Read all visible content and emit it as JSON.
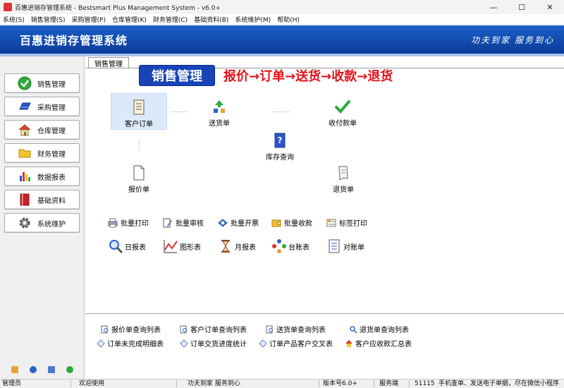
{
  "window": {
    "title": "百惠进销存管理系统 - Bestsmart Plus Management System - v6.0+",
    "minimize": "—",
    "maximize": "☐",
    "close": "✕"
  },
  "menu": [
    "系统(S)",
    "销售管理(S)",
    "采购管理(P)",
    "仓库管理(K)",
    "财务管理(C)",
    "基础资料(B)",
    "系统维护(M)",
    "帮助(H)"
  ],
  "banner": {
    "title": "百惠进销存管理系统",
    "slogan": "功夫到家 服务到心"
  },
  "sidebar": {
    "items": [
      {
        "label": "销售管理",
        "icon": "check-icon"
      },
      {
        "label": "采购管理",
        "icon": "card-icon"
      },
      {
        "label": "仓库管理",
        "icon": "house-icon"
      },
      {
        "label": "财务管理",
        "icon": "folder-icon"
      },
      {
        "label": "数据报表",
        "icon": "bar-chart-icon"
      },
      {
        "label": "基础资料",
        "icon": "book-icon"
      },
      {
        "label": "系统维护",
        "icon": "gear-icon"
      }
    ]
  },
  "main": {
    "tab": "销售管理",
    "heading": "销售管理",
    "flow": "报价→订单→送货→收款→退货",
    "nodes": {
      "order": "客户订单",
      "delivery": "送货单",
      "payment": "收付款单",
      "inventory": "库存查询",
      "quote": "报价单",
      "return": "退货单"
    },
    "tools": [
      "批量打印",
      "批量审核",
      "批量开票",
      "批量收款",
      "标签打印"
    ],
    "reports": [
      "日报表",
      "图形表",
      "月报表",
      "台账表",
      "对账单"
    ]
  },
  "query": {
    "row1": [
      "报价单查询列表",
      "客户订单查询列表",
      "送货单查询列表",
      "退货单查询列表"
    ],
    "row2": [
      "订单未完成明细表",
      "订单交货进度统计",
      "订单产品客户交叉表",
      "客户应收款汇总表"
    ]
  },
  "status": {
    "user": "管理员",
    "welcome": "欢迎使用",
    "slogan": "功夫到家 服务到心",
    "version": "版本号6.0+",
    "mode": "服务端",
    "code": "51115",
    "notice": "手机查单、发送电子单据，尽在微信小程序"
  },
  "colors": {
    "banner": "#0b3b97",
    "heading_bg": "#1844b8",
    "flow_text": "#e0141b"
  }
}
